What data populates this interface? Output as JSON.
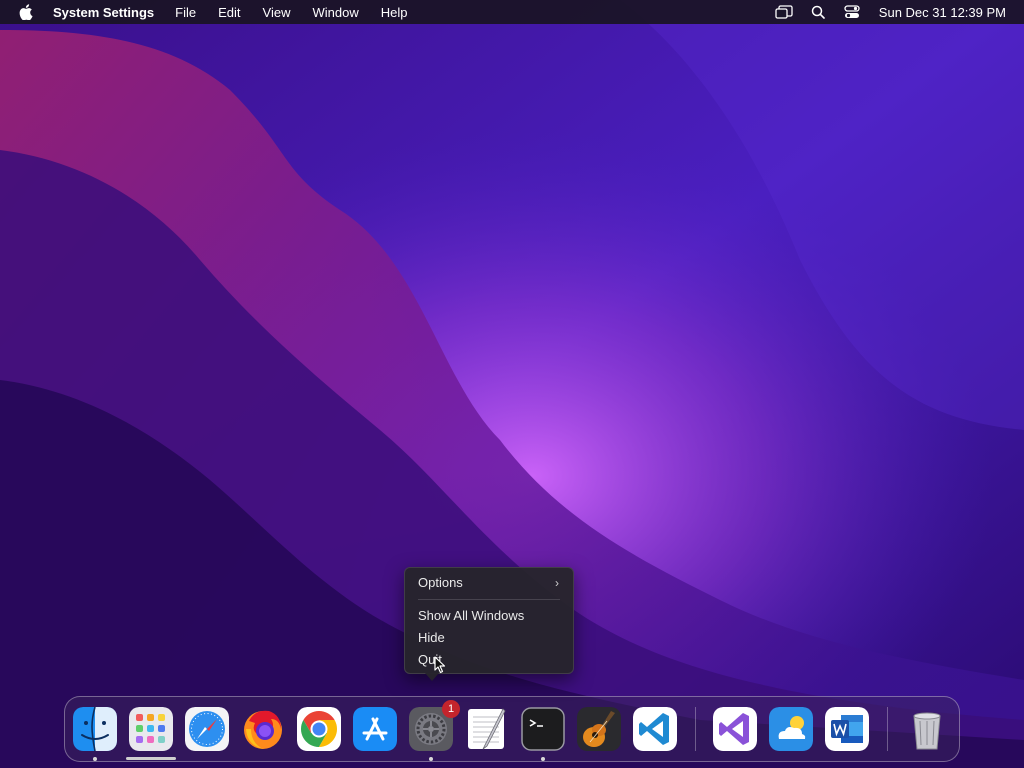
{
  "menubar": {
    "app_name": "System Settings",
    "items": [
      "File",
      "Edit",
      "View",
      "Window",
      "Help"
    ],
    "clock": "Sun Dec 31  12:39 PM",
    "icons": [
      "stage-manager-icon",
      "spotlight-search-icon",
      "control-center-icon"
    ]
  },
  "context_menu": {
    "options_label": "Options",
    "show_all_windows_label": "Show All Windows",
    "hide_label": "Hide",
    "quit_label": "Quit"
  },
  "dock": {
    "apps": [
      "finder",
      "launchpad",
      "safari",
      "firefox",
      "chrome",
      "app-store",
      "system-settings",
      "textedit",
      "terminal",
      "garageband",
      "vscode",
      "visual-studio",
      "weather",
      "word",
      "trash"
    ],
    "system_settings_badge": "1"
  },
  "colors": {
    "menubar_bg": "#19142a",
    "menu_bg": "#26242c",
    "badge_red": "#c4242c"
  }
}
